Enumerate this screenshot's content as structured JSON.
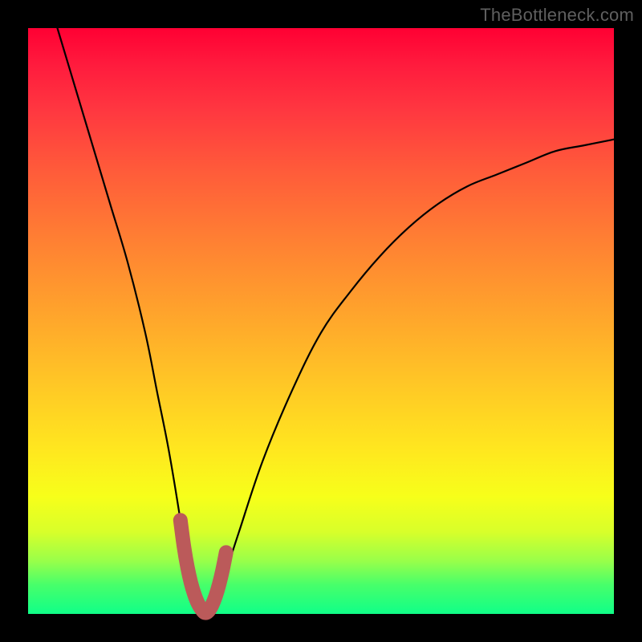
{
  "attribution": "TheBottleneck.com",
  "chart_data": {
    "type": "line",
    "title": "",
    "xlabel": "",
    "ylabel": "",
    "xlim": [
      0,
      100
    ],
    "ylim": [
      0,
      100
    ],
    "curve": {
      "name": "bottleneck-curve",
      "color": "#000000",
      "x": [
        5,
        8,
        11,
        14,
        17,
        20,
        22,
        24,
        26,
        27,
        28,
        29,
        30,
        31,
        32,
        34,
        36,
        40,
        45,
        50,
        55,
        60,
        65,
        70,
        75,
        80,
        85,
        90,
        95,
        100
      ],
      "y": [
        100,
        90,
        80,
        70,
        60,
        48,
        38,
        28,
        16,
        9,
        4,
        1,
        0,
        1,
        3,
        8,
        14,
        26,
        38,
        48,
        55,
        61,
        66,
        70,
        73,
        75,
        77,
        79,
        80,
        81
      ]
    },
    "highlight": {
      "name": "optimal-range-marker",
      "color": "#bb5a5a",
      "x": [
        26.0,
        26.6,
        27.2,
        27.8,
        28.4,
        29.0,
        29.6,
        30.2,
        30.8,
        31.4,
        32.0,
        32.6,
        33.2,
        33.8
      ],
      "y": [
        16.0,
        11.5,
        8.0,
        5.3,
        3.3,
        1.8,
        0.8,
        0.2,
        0.5,
        1.5,
        3.0,
        5.0,
        7.5,
        10.5
      ]
    }
  }
}
